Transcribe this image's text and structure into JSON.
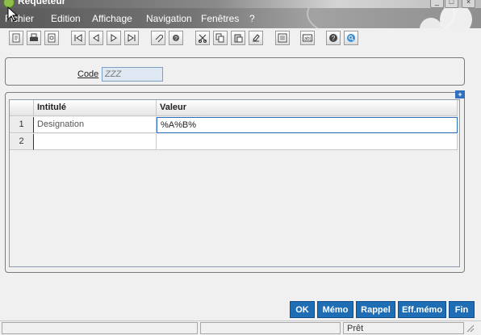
{
  "window": {
    "title": "Requêteur",
    "controls": [
      "_",
      "□",
      "×"
    ]
  },
  "menu": [
    {
      "label": "Fichier"
    },
    {
      "label": "Edition"
    },
    {
      "label": "Affichage"
    },
    {
      "label": "Navigation"
    },
    {
      "label": "Fenêtres"
    },
    {
      "label": "?"
    }
  ],
  "toolbar": {
    "icons": [
      "new-doc-icon",
      "print-icon",
      "print-preview-icon",
      "first-record-icon",
      "previous-record-icon",
      "next-record-icon",
      "last-record-icon",
      "attach-icon",
      "settings-icon",
      "cut-icon",
      "copy-icon",
      "paste-icon",
      "clear-icon",
      "form-icon",
      "text-field-icon",
      "help-icon",
      "search-icon"
    ]
  },
  "form": {
    "code_label": "Code",
    "code_value": "ZZZ"
  },
  "grid": {
    "columns": [
      "Intitulé",
      "Valeur"
    ],
    "rows": [
      {
        "num": "1",
        "intitule": "Designation",
        "valeur": "%A%B%"
      },
      {
        "num": "2",
        "intitule": "",
        "valeur": ""
      }
    ],
    "add_button": "+"
  },
  "actions": {
    "ok": "OK",
    "memo": "Mémo",
    "rappel": "Rappel",
    "effmemo": "Eff.mémo",
    "fin": "Fin"
  },
  "status": {
    "text": "Prêt"
  },
  "colors": {
    "accent": "#1f6db5"
  }
}
